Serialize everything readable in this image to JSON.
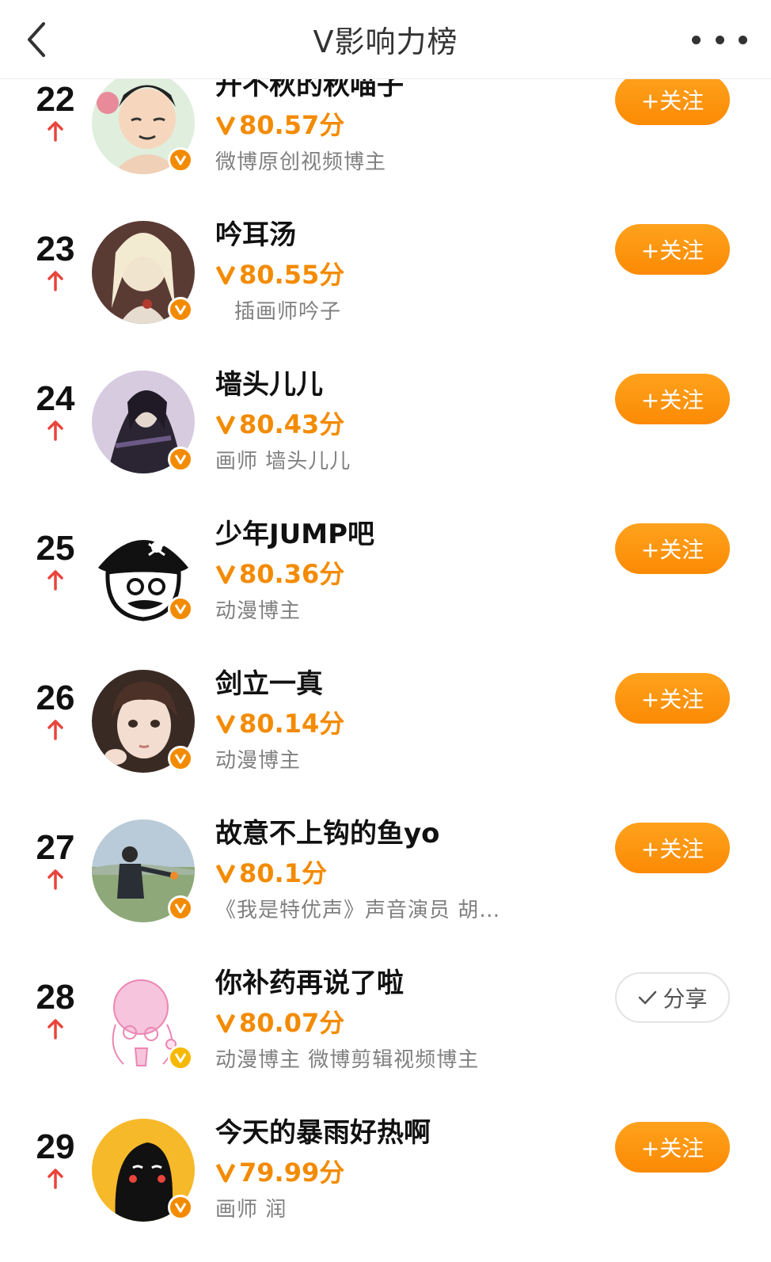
{
  "header": {
    "title": "V影响力榜"
  },
  "colors": {
    "accent": "#f38b00",
    "up_arrow": "#e8453c",
    "follow_gradient_top": "#ffa21d"
  },
  "rows": [
    {
      "rank": "22",
      "name": "开不秋的秋喵子",
      "score": "80.57分",
      "desc": "微博原创视频博主",
      "action": "+关注",
      "avatar": "cartoon-man-avatar"
    },
    {
      "rank": "23",
      "name": "吟耳汤",
      "score": "80.55分",
      "desc": "插画师吟子",
      "action": "+关注",
      "avatar": "illustrated-portrait-avatar"
    },
    {
      "rank": "24",
      "name": "墙头儿儿",
      "score": "80.43分",
      "desc": "画师 墙头儿儿",
      "action": "+关注",
      "avatar": "dark-character-avatar"
    },
    {
      "rank": "25",
      "name": "少年JUMP吧",
      "score": "80.36分",
      "desc": "动漫博主",
      "action": "+关注",
      "avatar": "pirate-avatar"
    },
    {
      "rank": "26",
      "name": "剑立一真",
      "score": "80.14分",
      "desc": "动漫博主",
      "action": "+关注",
      "avatar": "girl-photo-avatar"
    },
    {
      "rank": "27",
      "name": "故意不上钩的鱼yo",
      "score": "80.1分",
      "desc": "《我是特优声》声音演员 胡…",
      "action": "+关注",
      "avatar": "landscape-photo-avatar"
    },
    {
      "rank": "28",
      "name": "你补药再说了啦",
      "score": "80.07分",
      "desc": "动漫博主 微博剪辑视频博主",
      "action": "分享",
      "avatar": "pink-sketch-avatar"
    },
    {
      "rank": "29",
      "name": "今天的暴雨好热啊",
      "score": "79.99分",
      "desc": "画师 润",
      "action": "+关注",
      "avatar": "black-blob-avatar"
    }
  ]
}
